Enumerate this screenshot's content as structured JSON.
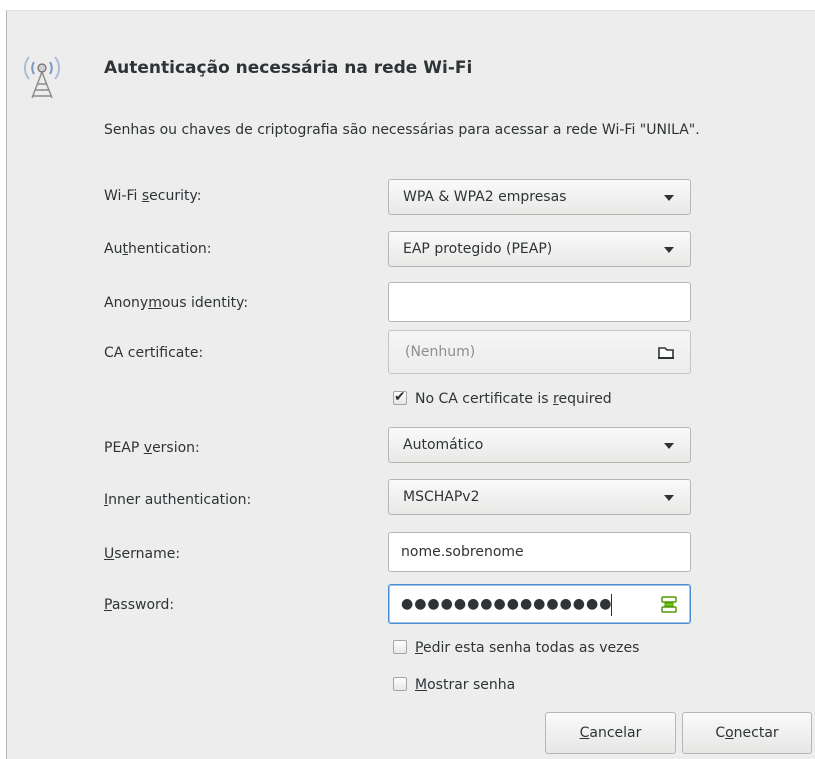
{
  "dialog": {
    "title": "Autenticação necessária na rede Wi-Fi",
    "subtitle": "Senhas ou chaves de criptografia são necessárias para acessar a rede Wi-Fi \"UNILA\"."
  },
  "form": {
    "wifi_security": {
      "label_pre": "Wi-Fi ",
      "label_mn": "s",
      "label_post": "ecurity:",
      "value": "WPA & WPA2 empresas"
    },
    "authentication": {
      "label_pre": "Au",
      "label_mn": "t",
      "label_post": "hentication:",
      "value": "EAP protegido (PEAP)"
    },
    "anonymous_identity": {
      "label_pre": "Anony",
      "label_mn": "m",
      "label_post": "ous identity:",
      "value": ""
    },
    "ca_certificate": {
      "label": "CA certificate:",
      "value": "(Nenhum)"
    },
    "no_ca_required": {
      "label_pre": "No CA certificate is ",
      "label_mn": "r",
      "label_post": "equired",
      "checked": true
    },
    "peap_version": {
      "label_pre": "PEAP ",
      "label_mn": "v",
      "label_post": "ersion:",
      "value": "Automático"
    },
    "inner_authentication": {
      "label_pre": "",
      "label_mn": "I",
      "label_post": "nner authentication:",
      "value": "MSCHAPv2"
    },
    "username": {
      "label_pre": "",
      "label_mn": "U",
      "label_post": "sername:",
      "value": "nome.sobrenome"
    },
    "password": {
      "label_pre": "",
      "label_mn": "P",
      "label_post": "assword:",
      "value": "●●●●●●●●●●●●●●●●"
    },
    "ask_every_time": {
      "label_pre": "",
      "label_mn": "P",
      "label_post": "edir esta senha todas as vezes",
      "checked": false
    },
    "show_password": {
      "label_pre": "",
      "label_mn": "M",
      "label_post": "ostrar senha",
      "checked": false
    }
  },
  "buttons": {
    "cancel": {
      "pre": "",
      "mn": "C",
      "post": "ancelar"
    },
    "connect": {
      "pre": "C",
      "mn": "o",
      "post": "nectar"
    }
  },
  "icons": {
    "dialog": "wireless-network-icon",
    "file": "document-open-icon",
    "password": "password-storage-icon"
  },
  "colors": {
    "background": "#ededed",
    "focus": "#4a90d9",
    "text": "#2e3436",
    "placeholder": "#8b8e8f",
    "password_icon": "#4e9a06"
  }
}
